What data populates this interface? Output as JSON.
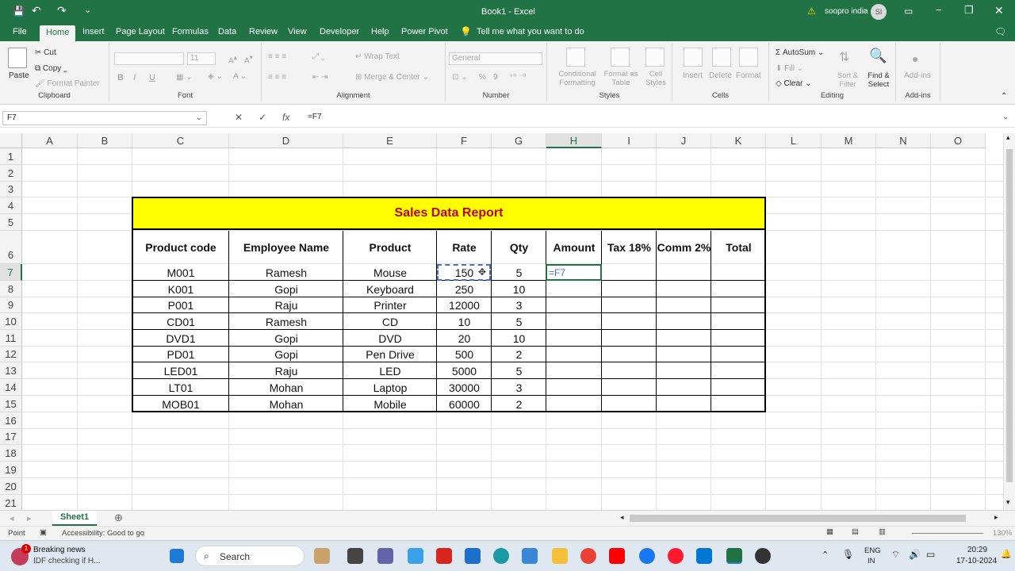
{
  "window": {
    "title": "Book1 - Excel",
    "user": "soopro india",
    "avatar": "SI"
  },
  "qat": {
    "save_icon": "💾",
    "undo_icon": "↶",
    "redo_icon": "↷",
    "more": "⌄"
  },
  "tabs": [
    "File",
    "Home",
    "Insert",
    "Page Layout",
    "Formulas",
    "Data",
    "Review",
    "View",
    "Developer",
    "Help",
    "Power Pivot"
  ],
  "tell_me": "Tell me what you want to do",
  "ribbon": {
    "clipboard": {
      "paste": "Paste",
      "cut": "Cut",
      "copy": "Copy",
      "format_painter": "Format Painter",
      "label": "Clipboard"
    },
    "font": {
      "font_size": "11",
      "bold": "B",
      "italic": "I",
      "underline": "U",
      "label": "Font"
    },
    "alignment": {
      "wrap": "Wrap Text",
      "merge": "Merge & Center",
      "label": "Alignment"
    },
    "number": {
      "format": "General",
      "percent": "%",
      "comma": "9",
      "label": "Number"
    },
    "styles": {
      "cond": "Conditional Formatting",
      "table": "Format as Table",
      "cell": "Cell Styles",
      "label": "Styles"
    },
    "cells": {
      "insert": "Insert",
      "delete": "Delete",
      "format": "Format",
      "label": "Cells"
    },
    "editing": {
      "autosum": "AutoSum",
      "fill": "Fill",
      "clear": "Clear",
      "sort": "Sort & Filter",
      "find": "Find & Select",
      "label": "Editing"
    },
    "addins": {
      "addins": "Add-ins",
      "label": "Add-ins"
    }
  },
  "formula_bar": {
    "name_box": "F7",
    "formula": "=F7",
    "fx": "fx"
  },
  "columns": [
    "A",
    "B",
    "C",
    "D",
    "E",
    "F",
    "G",
    "H",
    "I",
    "J",
    "K",
    "L",
    "M",
    "N",
    "O"
  ],
  "rows": [
    "1",
    "2",
    "3",
    "4",
    "5",
    "6",
    "7",
    "8",
    "9",
    "10",
    "11",
    "12",
    "13",
    "14",
    "15",
    "16",
    "17",
    "18",
    "19",
    "20",
    "21"
  ],
  "report": {
    "title": "Sales Data Report",
    "headers": [
      "Product code",
      "Employee Name",
      "Product",
      "Rate",
      "Qty",
      "Amount",
      "Tax 18%",
      "Comm 2%",
      "Total"
    ],
    "data": [
      [
        "M001",
        "Ramesh",
        "Mouse",
        "150",
        "5",
        "=F7"
      ],
      [
        "K001",
        "Gopi",
        "Keyboard",
        "250",
        "10",
        ""
      ],
      [
        "P001",
        "Raju",
        "Printer",
        "12000",
        "3",
        ""
      ],
      [
        "CD01",
        "Ramesh",
        "CD",
        "10",
        "5",
        ""
      ],
      [
        "DVD1",
        "Gopi",
        "DVD",
        "20",
        "10",
        ""
      ],
      [
        "PD01",
        "Gopi",
        "Pen Drive",
        "500",
        "2",
        ""
      ],
      [
        "LED01",
        "Raju",
        "LED",
        "5000",
        "5",
        ""
      ],
      [
        "LT01",
        "Mohan",
        "Laptop",
        "30000",
        "3",
        ""
      ],
      [
        "MOB01",
        "Mohan",
        "Mobile",
        "60000",
        "2",
        ""
      ]
    ]
  },
  "sheet_tab": "Sheet1",
  "status": {
    "mode": "Point",
    "accessibility": "Accessibility: Good to go",
    "zoom": "130%"
  },
  "taskbar": {
    "news_title": "Breaking news",
    "news_sub": "IDF checking if H...",
    "badge": "1",
    "search": "Search",
    "lang1": "ENG",
    "lang2": "IN",
    "time": "20:29",
    "date": "17-10-2024"
  },
  "colors": {
    "excel_green": "#217346",
    "banner": "#ffff00",
    "title_red": "#c00000"
  }
}
